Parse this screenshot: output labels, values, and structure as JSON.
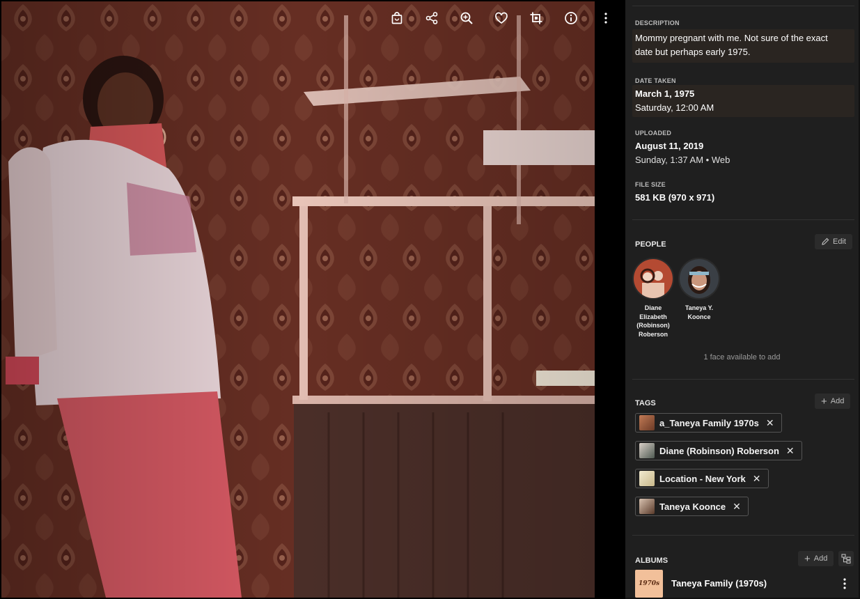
{
  "toolbar": {
    "icons": [
      "shopping-bag-icon",
      "share-icon",
      "zoom-in-icon",
      "heart-icon",
      "crop-icon",
      "info-icon",
      "more-vertical-icon"
    ]
  },
  "description": {
    "label": "DESCRIPTION",
    "text_line1": "Mommy pregnant with me. Not sure of the exact",
    "text_line2": "date but perhaps early 1975."
  },
  "date_taken": {
    "label": "DATE TAKEN",
    "date": "March 1, 1975",
    "detail": "Saturday, 12:00 AM"
  },
  "uploaded": {
    "label": "UPLOADED",
    "date": "August 11, 2019",
    "detail": "Sunday, 1:37 AM • Web"
  },
  "file_size": {
    "label": "FILE SIZE",
    "value": "581 KB (970 x 971)"
  },
  "people": {
    "label": "PEOPLE",
    "edit_label": "Edit",
    "persons": [
      {
        "name_line1": "Diane",
        "name_line2": "Elizabeth",
        "name_line3": "(Robinson)",
        "name_line4": "Roberson"
      },
      {
        "name_line1": "Taneya Y.",
        "name_line2": "Koonce"
      }
    ],
    "faces_note": "1 face available to add"
  },
  "tags": {
    "label": "TAGS",
    "add_label": "Add",
    "items": [
      {
        "label": "a_Taneya Family 1970s"
      },
      {
        "label": "Diane (Robinson) Roberson"
      },
      {
        "label": "Location - New York"
      },
      {
        "label": "Taneya Koonce"
      }
    ]
  },
  "albums": {
    "label": "ALBUMS",
    "add_label": "Add",
    "items": [
      {
        "title": "Taneya Family (1970s)",
        "thumb_text": "1970s"
      }
    ]
  },
  "colors": {
    "panel_bg": "#1f1f1f",
    "highlight_box": "#2a2521",
    "text_primary": "#ffffff",
    "text_muted": "#bdbdbd"
  }
}
